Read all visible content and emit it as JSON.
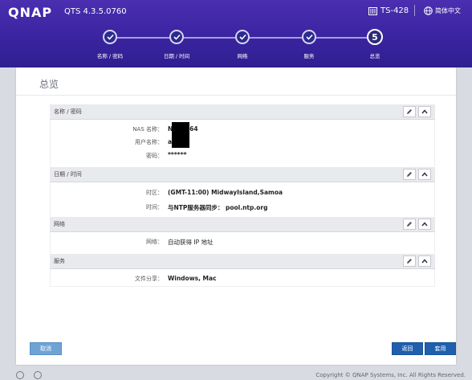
{
  "header": {
    "logo": "QNAP",
    "version": "QTS 4.3.5.0760",
    "model": "TS-428",
    "language": "简体中文"
  },
  "steps": [
    {
      "label": "名称 / 密码",
      "state": "done"
    },
    {
      "label": "日期 / 时间",
      "state": "done"
    },
    {
      "label": "网络",
      "state": "done"
    },
    {
      "label": "服务",
      "state": "done"
    },
    {
      "label": "总览",
      "state": "current",
      "number": "5"
    }
  ],
  "page_title": "总览",
  "sections": {
    "name_password": {
      "title": "名称 / 密码",
      "nas_name_label": "NAS 名称：",
      "nas_name_value": "N    2464",
      "user_label": "用户名称：",
      "user_value": "a",
      "password_label": "密码：",
      "password_value": "******"
    },
    "date_time": {
      "title": "日期 / 时间",
      "timezone_label": "时区：",
      "timezone_value": "(GMT-11:00) MidwayIsland,Samoa",
      "time_label": "时间：",
      "time_value": "与NTP服务器同步： pool.ntp.org"
    },
    "network": {
      "title": "网络",
      "network_label": "网络：",
      "network_value": "自动获得 IP 地址"
    },
    "services": {
      "title": "服务",
      "share_label": "文件分享：",
      "share_value": "Windows, Mac"
    }
  },
  "buttons": {
    "cancel": "取消",
    "back": "返回",
    "apply": "套用"
  },
  "footer": {
    "copyright": "Copyright © QNAP Systems, Inc. All Rights Reserved."
  },
  "colors": {
    "header": "#3a24a0",
    "primary_button": "#1f5fad",
    "cancel_button": "#6fa3d6"
  }
}
